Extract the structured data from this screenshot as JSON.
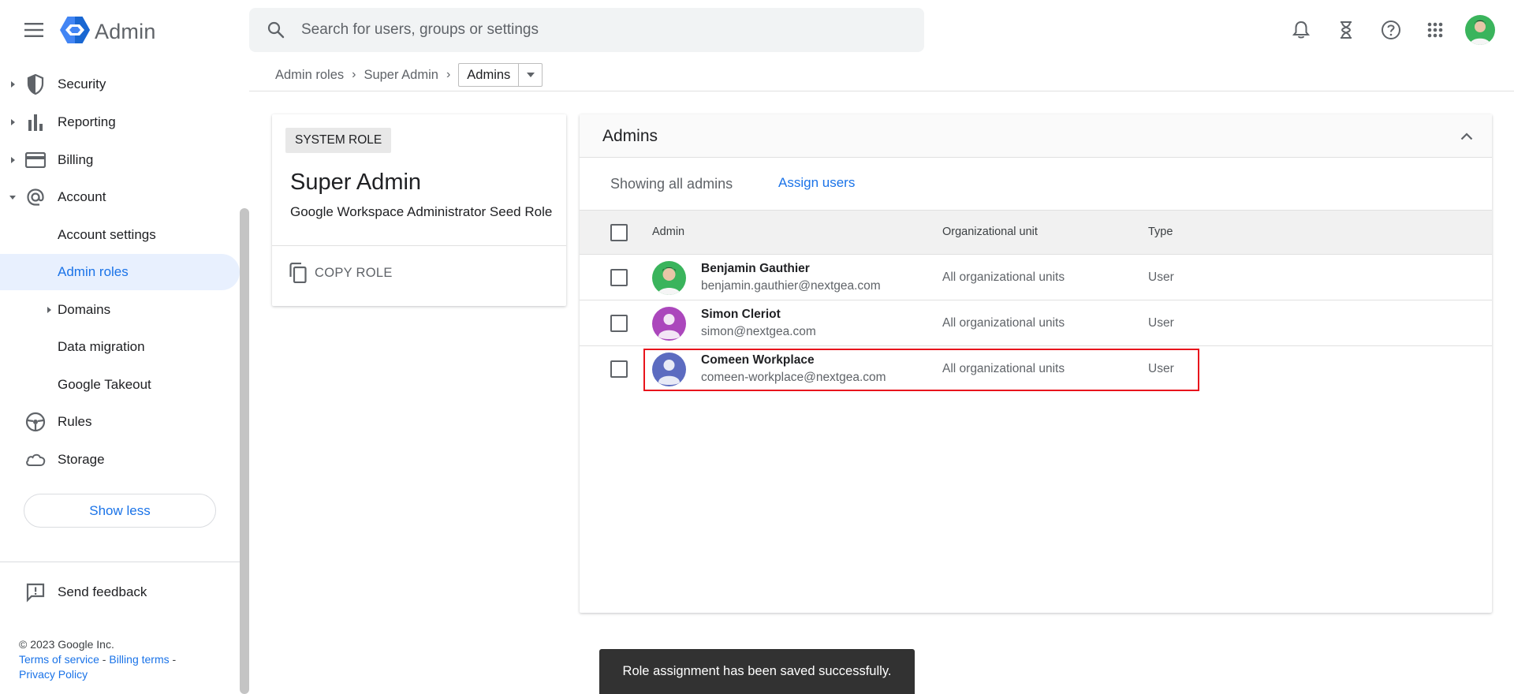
{
  "header": {
    "app_title": "Admin",
    "search_placeholder": "Search for users, groups or settings",
    "icons": [
      "notifications-icon",
      "hourglass-icon",
      "help-icon",
      "apps-grid-icon",
      "account-avatar"
    ]
  },
  "sidebar": {
    "items": [
      {
        "label": "Security",
        "icon": "shield-icon",
        "expandable": true
      },
      {
        "label": "Reporting",
        "icon": "bar-chart-icon",
        "expandable": true
      },
      {
        "label": "Billing",
        "icon": "credit-card-icon",
        "expandable": true
      },
      {
        "label": "Account",
        "icon": "at-sign-icon",
        "expanded": true
      },
      {
        "label": "Account settings"
      },
      {
        "label": "Admin roles",
        "active": true
      },
      {
        "label": "Domains",
        "expandable": true
      },
      {
        "label": "Data migration"
      },
      {
        "label": "Google Takeout"
      },
      {
        "label": "Rules",
        "icon": "rules-icon"
      },
      {
        "label": "Storage",
        "icon": "cloud-icon"
      }
    ],
    "show_less": "Show less",
    "send_feedback": "Send feedback",
    "footer": {
      "copyright": "© 2023 Google Inc.",
      "terms": "Terms of service",
      "billing_terms": "Billing terms",
      "privacy": "Privacy Policy",
      "sep": " - "
    }
  },
  "breadcrumb": {
    "items": [
      "Admin roles",
      "Super Admin"
    ],
    "current": "Admins",
    "sep": "›"
  },
  "role_card": {
    "chip": "SYSTEM ROLE",
    "title": "Super Admin",
    "description": "Google Workspace Administrator Seed Role",
    "copy_label": "COPY ROLE"
  },
  "admins_panel": {
    "title": "Admins",
    "showing": "Showing all admins",
    "assign_users": "Assign users",
    "columns": [
      "Admin",
      "Organizational unit",
      "Type"
    ],
    "rows": [
      {
        "name": "Benjamin Gauthier",
        "email": "benjamin.gauthier@nextgea.com",
        "org_unit": "All organizational units",
        "type": "User",
        "avatar_color": "#3ab45c"
      },
      {
        "name": "Simon Cleriot",
        "email": "simon@nextgea.com",
        "org_unit": "All organizational units",
        "type": "User",
        "avatar_color": "#ab47bc"
      },
      {
        "name": "Comeen Workplace",
        "email": "comeen-workplace@nextgea.com",
        "org_unit": "All organizational units",
        "type": "User",
        "avatar_color": "#5c6bc0"
      }
    ]
  },
  "snackbar": {
    "message": "Role assignment has been saved successfully."
  },
  "colors": {
    "accent": "#1a73e8",
    "active_bg": "#e8f0fe",
    "highlight": "#e8141c",
    "snackbar_bg": "#323232"
  }
}
